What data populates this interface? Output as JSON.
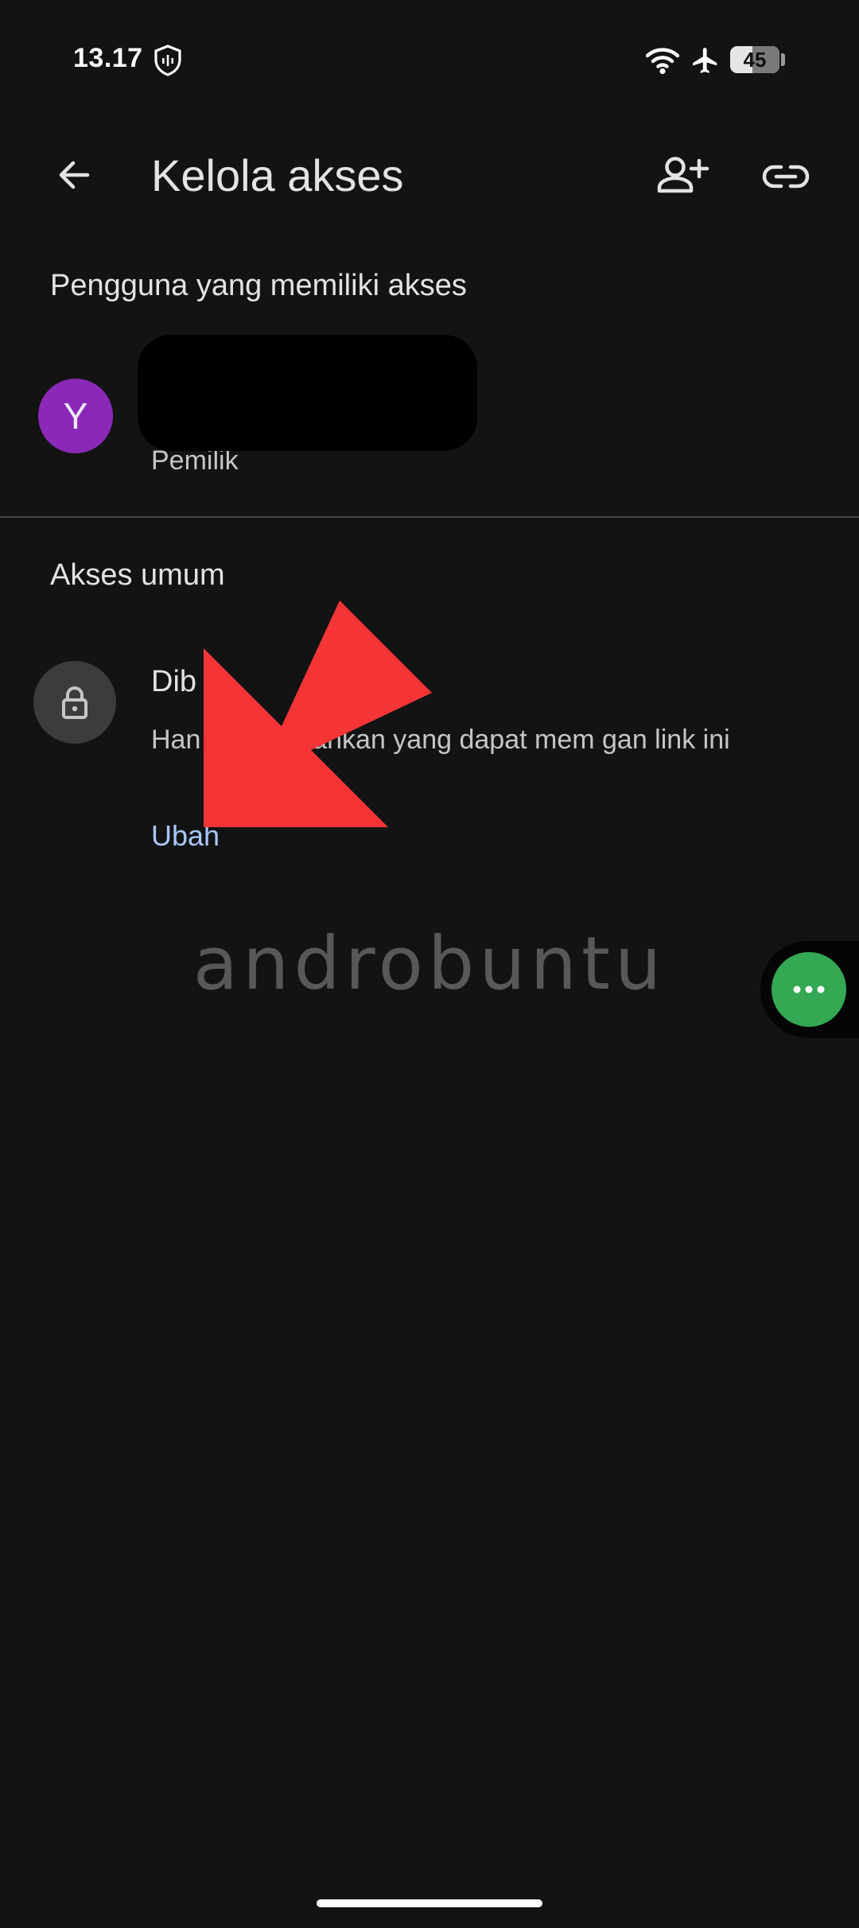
{
  "status_bar": {
    "time": "13.17",
    "battery_level": "45",
    "icons": [
      "shield-icon",
      "wifi-icon",
      "airplane-icon",
      "battery-icon"
    ]
  },
  "app_bar": {
    "title": "Kelola akses",
    "icons": [
      "back-arrow-icon",
      "add-person-icon",
      "link-icon"
    ]
  },
  "users_section": {
    "heading": "Pengguna yang memiliki akses",
    "owner": {
      "avatar_initial": "Y",
      "avatar_color": "#8a29b8",
      "role": "Pemilik"
    }
  },
  "general_access": {
    "heading": "Akses umum",
    "title": "Dib",
    "description": "Han                       g ditambahkan yang dapat mem                  gan link ini",
    "change_label": "Ubah",
    "icon": "lock-icon"
  },
  "overlay": {
    "arrow_color": "#f53435"
  },
  "watermark": {
    "text": "androbuntu"
  },
  "floating_bubble": {
    "color": "#34a853",
    "icon": "more-dots-icon"
  },
  "colors": {
    "background": "#131314",
    "link": "#a8c7fa",
    "text_primary": "#e3e3e3",
    "text_secondary": "#c4c7c5"
  }
}
